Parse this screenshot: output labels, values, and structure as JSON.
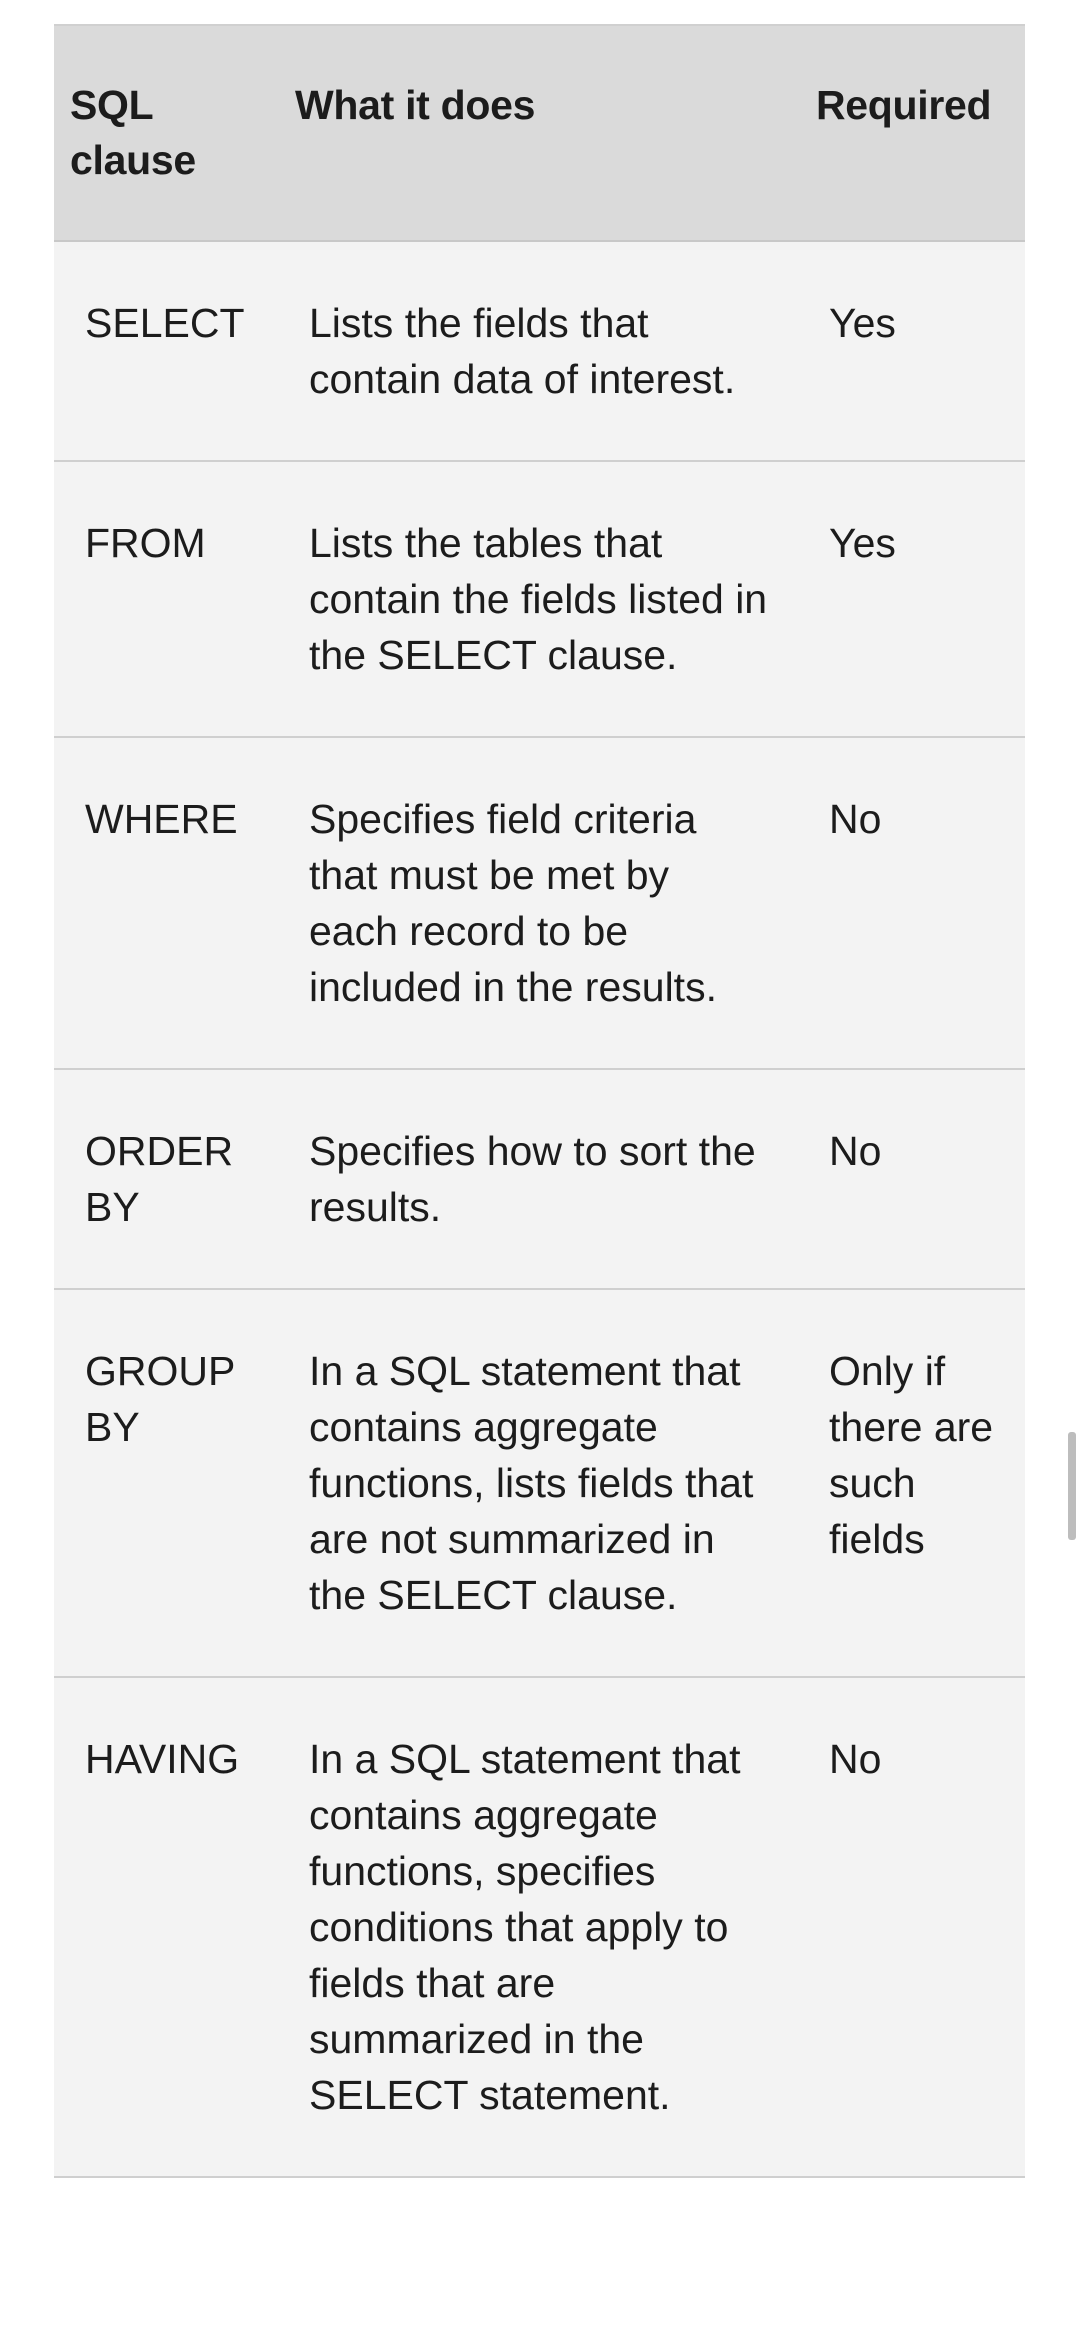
{
  "table": {
    "headers": [
      "SQL clause",
      "What it does",
      "Required"
    ],
    "rows": [
      {
        "clause": "SELECT",
        "description": "Lists the fields that contain data of interest.",
        "required": "Yes"
      },
      {
        "clause": "FROM",
        "description": "Lists the tables that contain the fields listed in the SELECT clause.",
        "required": "Yes"
      },
      {
        "clause": "WHERE",
        "description": "Specifies field criteria that must be met by each record to be included in the results.",
        "required": "No"
      },
      {
        "clause": "ORDER BY",
        "description": "Specifies how to sort the results.",
        "required": "No"
      },
      {
        "clause": "GROUP BY",
        "description": "In a SQL statement that contains aggregate functions, lists fields that are not summarized in the SELECT clause.",
        "required": "Only if there are such fields"
      },
      {
        "clause": "HAVING",
        "description": "In a SQL statement that contains aggregate functions, specifies conditions that apply to fields that are summarized in the SELECT statement.",
        "required": "No"
      }
    ]
  }
}
